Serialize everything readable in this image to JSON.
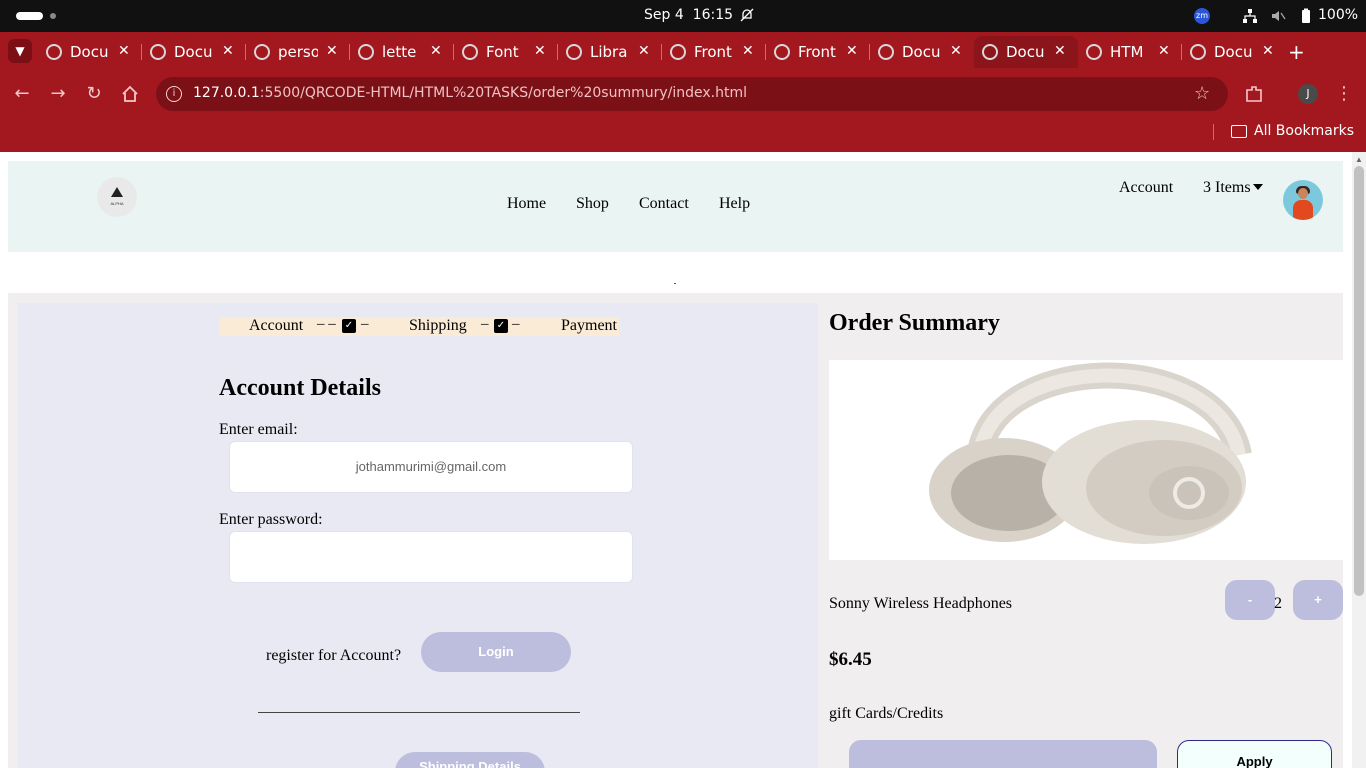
{
  "os": {
    "date": "Sep 4",
    "time": "16:15",
    "battery": "100%",
    "zoom_badge": "zm"
  },
  "browser": {
    "tabs": [
      {
        "title": "Docu",
        "icon": "globe-icon"
      },
      {
        "title": "Docu",
        "icon": "globe-icon"
      },
      {
        "title": "perso",
        "icon": "google-icon"
      },
      {
        "title": "lette",
        "icon": "google-icon"
      },
      {
        "title": "Font",
        "icon": "flag-icon"
      },
      {
        "title": "Libra",
        "icon": "code-icon"
      },
      {
        "title": "Front",
        "icon": "circle-icon"
      },
      {
        "title": "Front",
        "icon": "page-icon"
      },
      {
        "title": "Docu",
        "icon": "globe-icon"
      },
      {
        "title": "Docu",
        "icon": "globe-icon",
        "active": true
      },
      {
        "title": "HTM",
        "icon": "w-icon"
      },
      {
        "title": "Docu",
        "icon": "globe-icon"
      }
    ],
    "url_host": "127.0.0.1",
    "url_path": ":5500/QRCODE-HTML/HTML%20TASKS/order%20summury/index.html",
    "profile_initial": "J",
    "bookmarks_label": "All Bookmarks"
  },
  "site": {
    "logo_text": "ALPHA",
    "nav": [
      "Home",
      "Shop",
      "Contact",
      "Help"
    ],
    "account": "Account",
    "cart": "3 Items"
  },
  "checkout": {
    "steps": [
      "Account",
      "Shipping",
      "Payment"
    ],
    "form_title": "Account Details",
    "email_label": "Enter email:",
    "email_value": "jothammurimi@gmail.com",
    "password_label": "Enter password:",
    "register_text": "register for Account?",
    "login_label": "Login",
    "next_label": "Shipping Details"
  },
  "summary": {
    "title": "Order Summary",
    "product_name": "Sonny Wireless Headphones",
    "minus_label": "-",
    "plus_label": "+",
    "quantity": "2",
    "price": "$6.45",
    "gift_label": "gift Cards/Credits",
    "apply_label": "Apply"
  },
  "colors": {
    "browser_accent": "#a3181f",
    "header_bg": "#eaf4f3",
    "panel_bg": "#e9e9f4",
    "button_bg": "#bdbddd",
    "stepper_bg": "#faebd7"
  }
}
